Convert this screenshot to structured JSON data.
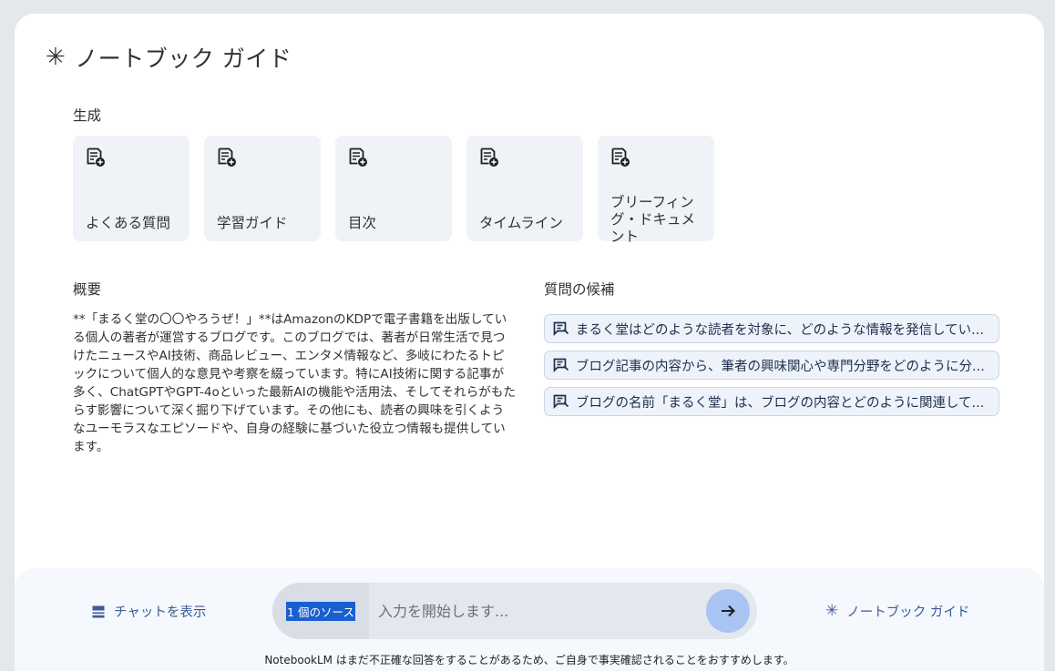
{
  "guide": {
    "title": "ノートブック ガイド",
    "icon": "asterisk-icon"
  },
  "generate": {
    "label": "生成",
    "cards": [
      {
        "label": "よくある質問",
        "icon": "note-add-icon"
      },
      {
        "label": "学習ガイド",
        "icon": "note-add-icon"
      },
      {
        "label": "目次",
        "icon": "note-add-icon"
      },
      {
        "label": "タイムライン",
        "icon": "note-add-icon"
      },
      {
        "label": "ブリーフィング・ドキュメント",
        "icon": "note-add-icon"
      }
    ]
  },
  "summary": {
    "label": "概要",
    "text": "**「まるく堂の〇〇やろうぜ！」**はAmazonのKDPで電子書籍を出版している個人の著者が運営するブログです。このブログでは、著者が日常生活で見つけたニュースやAI技術、商品レビュー、エンタメ情報など、多岐にわたるトピックについて個人的な意見や考察を綴っています。特にAI技術に関する記事が多く、ChatGPTやGPT-4oといった最新AIの機能や活用法、そしてそれらがもたらす影響について深く掘り下げています。その他にも、読者の興味を引くようなユーモラスなエピソードや、自身の経験に基づいた役立つ情報も提供しています。"
  },
  "suggestions": {
    "label": "質問の候補",
    "items": [
      "まるく堂はどのような読者を対象に、どのような情報を発信してい...",
      "ブログ記事の内容から、筆者の興味関心や専門分野をどのように分...",
      "ブログの名前「まるく堂」は、ブログの内容とどのように関連して..."
    ]
  },
  "bottom": {
    "show_chat": "チャットを表示",
    "source_chip": "1 個のソース",
    "input_placeholder": "入力を開始します...",
    "notebook_guide": "ノートブック ガイド",
    "disclaimer": "NotebookLM はまだ不正確な回答をすることがあるため、ご自身で事実確認されることをおすすめします。"
  },
  "colors": {
    "accent": "#3d5a99",
    "send_button": "#a9c4f2",
    "selection": "#1a5fd0"
  }
}
